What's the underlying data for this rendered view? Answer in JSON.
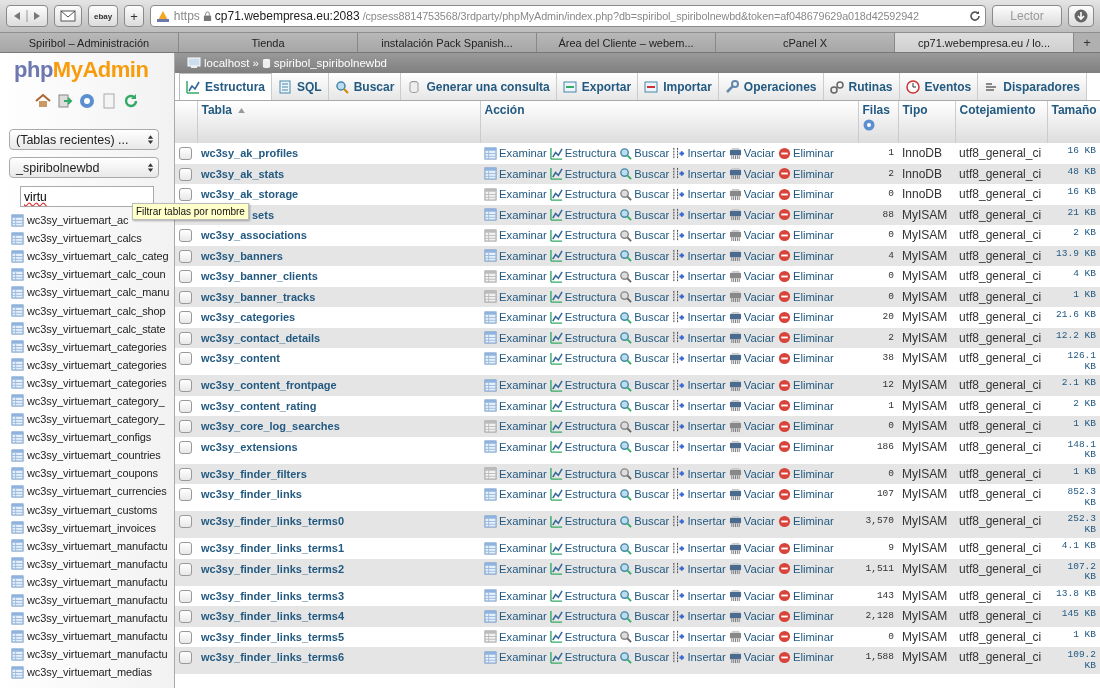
{
  "browser": {
    "ebay_button": "ebay",
    "new_bookmark_button": "+",
    "url": {
      "scheme": "https",
      "host": "cp71.webempresa.eu:2083",
      "path": "/cpsess8814753568/3rdparty/phpMyAdmin/index.php?db=spiribol_spiribolnewbd&token=af048679629a018d42592942"
    },
    "reader_button": "Lector",
    "tabs": [
      {
        "label": "Spiribol – Administración",
        "selected": false
      },
      {
        "label": "Tienda",
        "selected": false
      },
      {
        "label": "instalación Pack Spanish...",
        "selected": false
      },
      {
        "label": "Área del Cliente – webem...",
        "selected": false
      },
      {
        "label": "cPanel X",
        "selected": false
      },
      {
        "label": "cp71.webempresa.eu / lo...",
        "selected": true
      }
    ],
    "new_tab_button": "+"
  },
  "sidebar": {
    "logo": {
      "part1": "php",
      "part2": "MyAdmin"
    },
    "recent_select": "(Tablas recientes) ...",
    "database_select": "_spiribolnewbd",
    "filter": {
      "value": "virtu"
    },
    "tooltip": "Filtrar tablas por nombre",
    "items": [
      "wc3sy_virtuemart_ac",
      "wc3sy_virtuemart_calcs",
      "wc3sy_virtuemart_calc_categ",
      "wc3sy_virtuemart_calc_coun",
      "wc3sy_virtuemart_calc_manu",
      "wc3sy_virtuemart_calc_shop",
      "wc3sy_virtuemart_calc_state",
      "wc3sy_virtuemart_categories",
      "wc3sy_virtuemart_categories",
      "wc3sy_virtuemart_categories",
      "wc3sy_virtuemart_category_",
      "wc3sy_virtuemart_category_",
      "wc3sy_virtuemart_configs",
      "wc3sy_virtuemart_countries",
      "wc3sy_virtuemart_coupons",
      "wc3sy_virtuemart_currencies",
      "wc3sy_virtuemart_customs",
      "wc3sy_virtuemart_invoices",
      "wc3sy_virtuemart_manufactu",
      "wc3sy_virtuemart_manufactu",
      "wc3sy_virtuemart_manufactu",
      "wc3sy_virtuemart_manufactu",
      "wc3sy_virtuemart_manufactu",
      "wc3sy_virtuemart_manufactu",
      "wc3sy_virtuemart_manufactu",
      "wc3sy_virtuemart_medias"
    ]
  },
  "breadcrumb": {
    "server": "localhost",
    "separator": "»",
    "database": "spiribol_spiribolnewbd"
  },
  "tabs": [
    {
      "label": "Estructura",
      "selected": true
    },
    {
      "label": "SQL",
      "selected": false
    },
    {
      "label": "Buscar",
      "selected": false
    },
    {
      "label": "Generar una consulta",
      "selected": false
    },
    {
      "label": "Exportar",
      "selected": false
    },
    {
      "label": "Importar",
      "selected": false
    },
    {
      "label": "Operaciones",
      "selected": false
    },
    {
      "label": "Rutinas",
      "selected": false
    },
    {
      "label": "Eventos",
      "selected": false
    },
    {
      "label": "Disparadores",
      "selected": false
    }
  ],
  "table": {
    "columns": [
      "Tabla",
      "Acción",
      "Filas",
      "Tipo",
      "Cotejamiento",
      "Tamaño"
    ],
    "rows": [
      {
        "name": "wc3sy_ak_profiles",
        "kind": "full",
        "checked": false,
        "empty": false,
        "actions": [
          "Examinar",
          "Estructura",
          "Buscar",
          "Insertar",
          "Vaciar",
          "Eliminar"
        ],
        "rows": "1",
        "type": "InnoDB",
        "collation": "utf8_general_ci",
        "size": "16 KB"
      },
      {
        "name": "wc3sy_ak_stats",
        "kind": "full",
        "checked": false,
        "empty": false,
        "actions": [
          "Examinar",
          "Estructura",
          "Buscar",
          "Insertar",
          "Vaciar",
          "Eliminar"
        ],
        "rows": "2",
        "type": "InnoDB",
        "collation": "utf8_general_ci",
        "size": "48 KB"
      },
      {
        "name": "wc3sy_ak_storage",
        "kind": "full",
        "checked": false,
        "empty": true,
        "actions": [
          "Examinar",
          "Estructura",
          "Buscar",
          "Insertar",
          "Vaciar",
          "Eliminar"
        ],
        "rows": "0",
        "type": "InnoDB",
        "collation": "utf8_general_ci",
        "size": "16 KB"
      },
      {
        "name": "sets",
        "kind": "covered",
        "empty": false,
        "actions": [
          "Examinar",
          "Estructura",
          "Buscar",
          "Insertar",
          "Vaciar",
          "Eliminar"
        ],
        "rows": "88",
        "type": "MyISAM",
        "collation": "utf8_general_ci",
        "size": "21 KB"
      },
      {
        "name": "wc3sy_associations",
        "kind": "full",
        "checked": false,
        "empty": true,
        "actions": [
          "Examinar",
          "Estructura",
          "Buscar",
          "Insertar",
          "Vaciar",
          "Eliminar"
        ],
        "rows": "0",
        "type": "MyISAM",
        "collation": "utf8_general_ci",
        "size": "2 KB"
      },
      {
        "name": "wc3sy_banners",
        "kind": "full",
        "checked": false,
        "empty": false,
        "actions": [
          "Examinar",
          "Estructura",
          "Buscar",
          "Insertar",
          "Vaciar",
          "Eliminar"
        ],
        "rows": "4",
        "type": "MyISAM",
        "collation": "utf8_general_ci",
        "size": "13.9 KB"
      },
      {
        "name": "wc3sy_banner_clients",
        "kind": "full",
        "checked": false,
        "empty": true,
        "actions": [
          "Examinar",
          "Estructura",
          "Buscar",
          "Insertar",
          "Vaciar",
          "Eliminar"
        ],
        "rows": "0",
        "type": "MyISAM",
        "collation": "utf8_general_ci",
        "size": "4 KB"
      },
      {
        "name": "wc3sy_banner_tracks",
        "kind": "full",
        "checked": false,
        "empty": true,
        "actions": [
          "Examinar",
          "Estructura",
          "Buscar",
          "Insertar",
          "Vaciar",
          "Eliminar"
        ],
        "rows": "0",
        "type": "MyISAM",
        "collation": "utf8_general_ci",
        "size": "1 KB"
      },
      {
        "name": "wc3sy_categories",
        "kind": "full",
        "checked": false,
        "empty": false,
        "actions": [
          "Examinar",
          "Estructura",
          "Buscar",
          "Insertar",
          "Vaciar",
          "Eliminar"
        ],
        "rows": "20",
        "type": "MyISAM",
        "collation": "utf8_general_ci",
        "size": "21.6 KB"
      },
      {
        "name": "wc3sy_contact_details",
        "kind": "full",
        "checked": false,
        "empty": false,
        "actions": [
          "Examinar",
          "Estructura",
          "Buscar",
          "Insertar",
          "Vaciar",
          "Eliminar"
        ],
        "rows": "2",
        "type": "MyISAM",
        "collation": "utf8_general_ci",
        "size": "12.2 KB"
      },
      {
        "name": "wc3sy_content",
        "kind": "full",
        "checked": false,
        "empty": false,
        "actions": [
          "Examinar",
          "Estructura",
          "Buscar",
          "Insertar",
          "Vaciar",
          "Eliminar"
        ],
        "rows": "38",
        "type": "MyISAM",
        "collation": "utf8_general_ci",
        "size": "126.1 KB"
      },
      {
        "name": "wc3sy_content_frontpage",
        "kind": "full",
        "checked": false,
        "empty": false,
        "actions": [
          "Examinar",
          "Estructura",
          "Buscar",
          "Insertar",
          "Vaciar",
          "Eliminar"
        ],
        "rows": "12",
        "type": "MyISAM",
        "collation": "utf8_general_ci",
        "size": "2.1 KB"
      },
      {
        "name": "wc3sy_content_rating",
        "kind": "full",
        "checked": false,
        "empty": false,
        "actions": [
          "Examinar",
          "Estructura",
          "Buscar",
          "Insertar",
          "Vaciar",
          "Eliminar"
        ],
        "rows": "1",
        "type": "MyISAM",
        "collation": "utf8_general_ci",
        "size": "2 KB"
      },
      {
        "name": "wc3sy_core_log_searches",
        "kind": "full",
        "checked": false,
        "empty": true,
        "actions": [
          "Examinar",
          "Estructura",
          "Buscar",
          "Insertar",
          "Vaciar",
          "Eliminar"
        ],
        "rows": "0",
        "type": "MyISAM",
        "collation": "utf8_general_ci",
        "size": "1 KB"
      },
      {
        "name": "wc3sy_extensions",
        "kind": "full",
        "checked": false,
        "empty": false,
        "actions": [
          "Examinar",
          "Estructura",
          "Buscar",
          "Insertar",
          "Vaciar",
          "Eliminar"
        ],
        "rows": "186",
        "type": "MyISAM",
        "collation": "utf8_general_ci",
        "size": "148.1 KB"
      },
      {
        "name": "wc3sy_finder_filters",
        "kind": "full",
        "checked": false,
        "empty": true,
        "actions": [
          "Examinar",
          "Estructura",
          "Buscar",
          "Insertar",
          "Vaciar",
          "Eliminar"
        ],
        "rows": "0",
        "type": "MyISAM",
        "collation": "utf8_general_ci",
        "size": "1 KB"
      },
      {
        "name": "wc3sy_finder_links",
        "kind": "full",
        "checked": false,
        "empty": false,
        "actions": [
          "Examinar",
          "Estructura",
          "Buscar",
          "Insertar",
          "Vaciar",
          "Eliminar"
        ],
        "rows": "107",
        "type": "MyISAM",
        "collation": "utf8_general_ci",
        "size": "852.3 KB"
      },
      {
        "name": "wc3sy_finder_links_terms0",
        "kind": "full",
        "checked": false,
        "empty": false,
        "actions": [
          "Examinar",
          "Estructura",
          "Buscar",
          "Insertar",
          "Vaciar",
          "Eliminar"
        ],
        "rows": "3,570",
        "type": "MyISAM",
        "collation": "utf8_general_ci",
        "size": "252.3 KB"
      },
      {
        "name": "wc3sy_finder_links_terms1",
        "kind": "full",
        "checked": false,
        "empty": false,
        "actions": [
          "Examinar",
          "Estructura",
          "Buscar",
          "Insertar",
          "Vaciar",
          "Eliminar"
        ],
        "rows": "9",
        "type": "MyISAM",
        "collation": "utf8_general_ci",
        "size": "4.1 KB"
      },
      {
        "name": "wc3sy_finder_links_terms2",
        "kind": "full",
        "checked": false,
        "empty": false,
        "actions": [
          "Examinar",
          "Estructura",
          "Buscar",
          "Insertar",
          "Vaciar",
          "Eliminar"
        ],
        "rows": "1,511",
        "type": "MyISAM",
        "collation": "utf8_general_ci",
        "size": "107.2 KB"
      },
      {
        "name": "wc3sy_finder_links_terms3",
        "kind": "full",
        "checked": false,
        "empty": false,
        "actions": [
          "Examinar",
          "Estructura",
          "Buscar",
          "Insertar",
          "Vaciar",
          "Eliminar"
        ],
        "rows": "143",
        "type": "MyISAM",
        "collation": "utf8_general_ci",
        "size": "13.8 KB"
      },
      {
        "name": "wc3sy_finder_links_terms4",
        "kind": "full",
        "checked": false,
        "empty": false,
        "actions": [
          "Examinar",
          "Estructura",
          "Buscar",
          "Insertar",
          "Vaciar",
          "Eliminar"
        ],
        "rows": "2,128",
        "type": "MyISAM",
        "collation": "utf8_general_ci",
        "size": "145 KB"
      },
      {
        "name": "wc3sy_finder_links_terms5",
        "kind": "full",
        "checked": false,
        "empty": true,
        "actions": [
          "Examinar",
          "Estructura",
          "Buscar",
          "Insertar",
          "Vaciar",
          "Eliminar"
        ],
        "rows": "0",
        "type": "MyISAM",
        "collation": "utf8_general_ci",
        "size": "1 KB"
      },
      {
        "name": "wc3sy_finder_links_terms6",
        "kind": "full",
        "checked": false,
        "empty": false,
        "actions": [
          "Examinar",
          "Estructura",
          "Buscar",
          "Insertar",
          "Vaciar",
          "Eliminar"
        ],
        "rows": "1,588",
        "type": "MyISAM",
        "collation": "utf8_general_ci",
        "size": "109.2 KB"
      }
    ]
  }
}
